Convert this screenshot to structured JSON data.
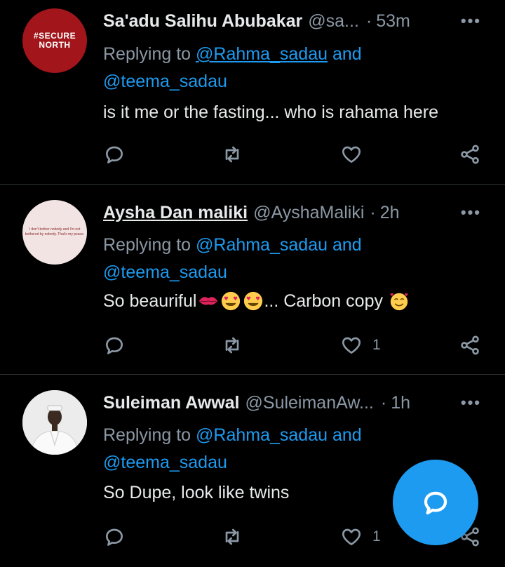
{
  "tweets": [
    {
      "avatar_text": "#SECURE NORTH",
      "name": "Sa'adu Salihu Abubakar",
      "handle": "@sa...",
      "separator": "·",
      "time": "53m",
      "more": "•••",
      "reply_prefix": "Replying to",
      "mention1": "@Rahma_sadau",
      "reply_and": "and",
      "mention2": "@teema_sadau",
      "text": "is it me or the fasting... who is rahama here",
      "like_count": ""
    },
    {
      "avatar_text": "I don't bother nobody and I'm not bothered by nobody. That's my peace.",
      "name": "Aysha Dan maliki",
      "handle": "@AyshaMaliki",
      "separator": "·",
      "time": "2h",
      "more": "•••",
      "reply_prefix": "Replying to",
      "mention1": "@Rahma_sadau",
      "reply_and": "and",
      "mention2": "@teema_sadau",
      "text_before": "So beauriful",
      "text_middle": "... Carbon copy",
      "like_count": "1"
    },
    {
      "name": "Suleiman Awwal",
      "handle": "@SuleimanAw...",
      "separator": "·",
      "time": "1h",
      "more": "•••",
      "reply_prefix": "Replying to",
      "mention1": "@Rahma_sadau",
      "reply_and": "and",
      "mention2": "@teema_sadau",
      "text": "So Dupe, look like twins",
      "like_count": "1"
    }
  ],
  "icons": {
    "reply": "reply-icon",
    "retweet": "retweet-icon",
    "like": "heart-icon",
    "share": "share-icon",
    "compose": "compose-reply-icon"
  },
  "colors": {
    "background": "#000000",
    "accent": "#1d9bf0",
    "secondary_text": "#8b98a5",
    "divider": "#2f3336"
  }
}
